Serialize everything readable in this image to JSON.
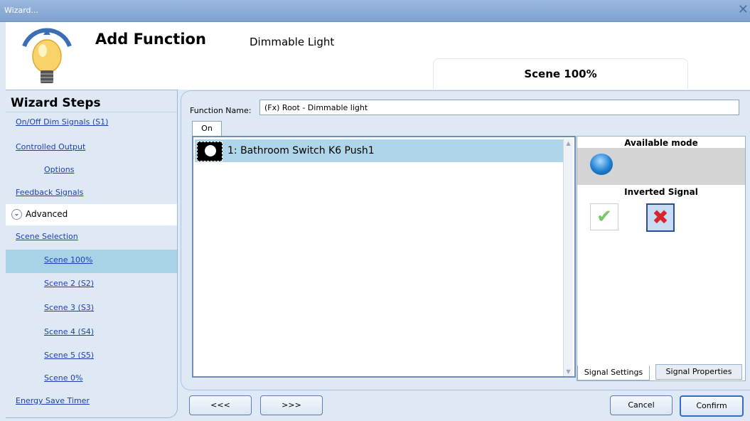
{
  "window": {
    "title": "Wizard...",
    "close_icon": "close-icon"
  },
  "header": {
    "title": "Add Function",
    "subtitle": "Dimmable Light",
    "scene_tab": "Scene 100%"
  },
  "sidebar": {
    "heading": "Wizard Steps",
    "items": [
      {
        "label": "On/Off Dim Signals (S1)"
      },
      {
        "label": "Controlled Output"
      },
      {
        "label": "Options"
      },
      {
        "label": "Feedback Signals"
      },
      {
        "label": "Advanced"
      },
      {
        "label": "Scene Selection"
      },
      {
        "label": "Scene 100%"
      },
      {
        "label": "Scene 2 (S2)"
      },
      {
        "label": "Scene 3 (S3)"
      },
      {
        "label": "Scene 4 (S4)"
      },
      {
        "label": "Scene 5 (S5)"
      },
      {
        "label": "Scene 0%"
      },
      {
        "label": "Energy Save Timer"
      }
    ]
  },
  "main": {
    "function_name_label": "Function Name:",
    "function_name_value": "(Fx) Root - Dimmable light",
    "tab_on": "On",
    "signals": [
      {
        "label": "1: Bathroom Switch K6 Push1"
      }
    ],
    "right_panel": {
      "available_mode_label": "Available mode",
      "inverted_signal_label": "Inverted Signal",
      "tab_signal_settings": "Signal Settings",
      "tab_signal_properties": "Signal Properties"
    }
  },
  "footer": {
    "prev": "<<<",
    "next": ">>>",
    "cancel": "Cancel",
    "confirm": "Confirm"
  }
}
